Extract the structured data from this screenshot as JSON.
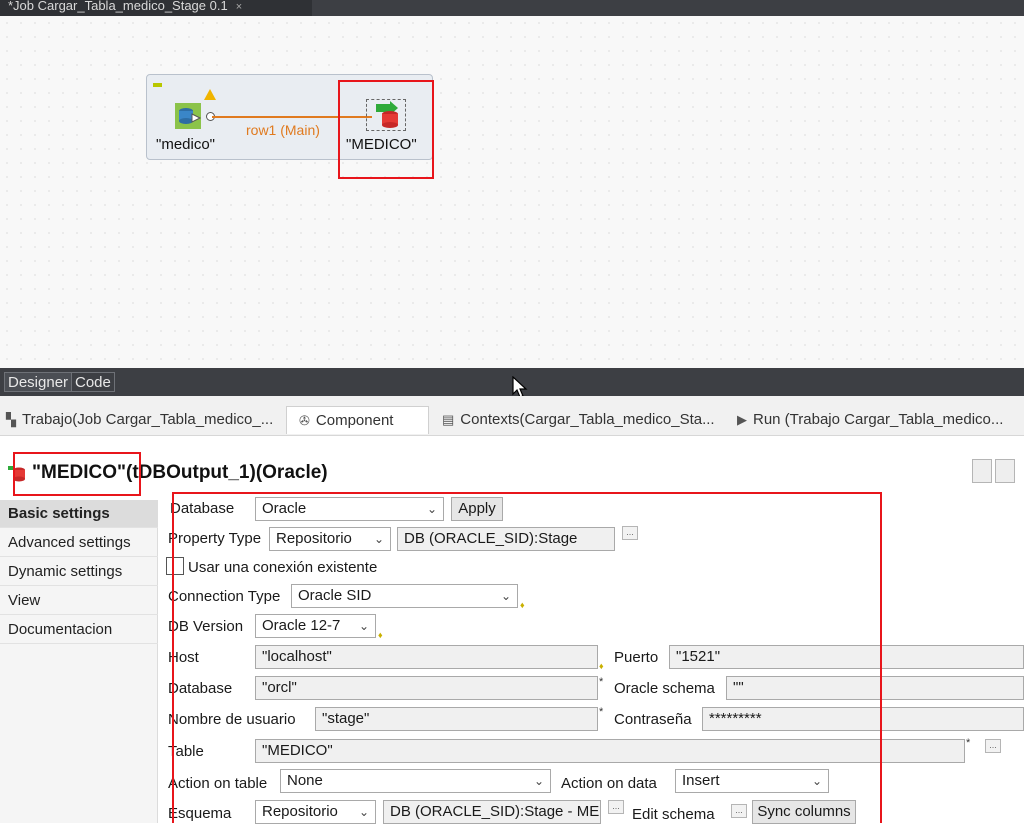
{
  "job_tab": {
    "title": "*Job Cargar_Tabla_medico_Stage 0.1",
    "close": "×"
  },
  "canvas": {
    "source_label": "\"medico\"",
    "target_label": "\"MEDICO\"",
    "connection_label": "row1 (Main)"
  },
  "editor_tabs": {
    "designer": "Designer",
    "code": "Code"
  },
  "view_tabs": [
    {
      "label": "Trabajo(Job Cargar_Tabla_medico_...",
      "icon": "job-icon"
    },
    {
      "label": "Component",
      "icon": "component-icon"
    },
    {
      "label": "Contexts(Cargar_Tabla_medico_Sta...",
      "icon": "contexts-icon"
    },
    {
      "label": "Run (Trabajo Cargar_Tabla_medico...",
      "icon": "run-icon"
    }
  ],
  "component": {
    "title": "\"MEDICO\"(tDBOutput_1)(Oracle)"
  },
  "settings_nav": [
    "Basic settings",
    "Advanced settings",
    "Dynamic settings",
    "View",
    "Documentacion"
  ],
  "form": {
    "database_label": "Database",
    "database_value": "Oracle",
    "apply_label": "Apply",
    "property_type_label": "Property Type",
    "property_type_value": "Repositorio",
    "property_repo_value": "DB (ORACLE_SID):Stage",
    "use_existing_label": "Usar una conexión existente",
    "connection_type_label": "Connection Type",
    "connection_type_value": "Oracle SID",
    "db_version_label": "DB Version",
    "db_version_value": "Oracle 12-7",
    "host_label": "Host",
    "host_value": "\"localhost\"",
    "puerto_label": "Puerto",
    "puerto_value": "\"1521\"",
    "database2_label": "Database",
    "database2_value": "\"orcl\"",
    "oracle_schema_label": "Oracle schema",
    "oracle_schema_value": "\"\"",
    "user_label": "Nombre de usuario",
    "user_value": "\"stage\"",
    "password_label": "Contraseña",
    "password_value": "*********",
    "table_label": "Table",
    "table_value": "\"MEDICO\"",
    "action_table_label": "Action on table",
    "action_table_value": "None",
    "action_data_label": "Action on data",
    "action_data_value": "Insert",
    "esquema_label": "Esquema",
    "esquema_value": "Repositorio",
    "esquema_repo_value": "DB (ORACLE_SID):Stage - MEDICO",
    "edit_schema_label": "Edit schema",
    "sync_columns_label": "Sync columns",
    "dots": "...",
    "star": "*",
    "chevron": "⌄"
  }
}
